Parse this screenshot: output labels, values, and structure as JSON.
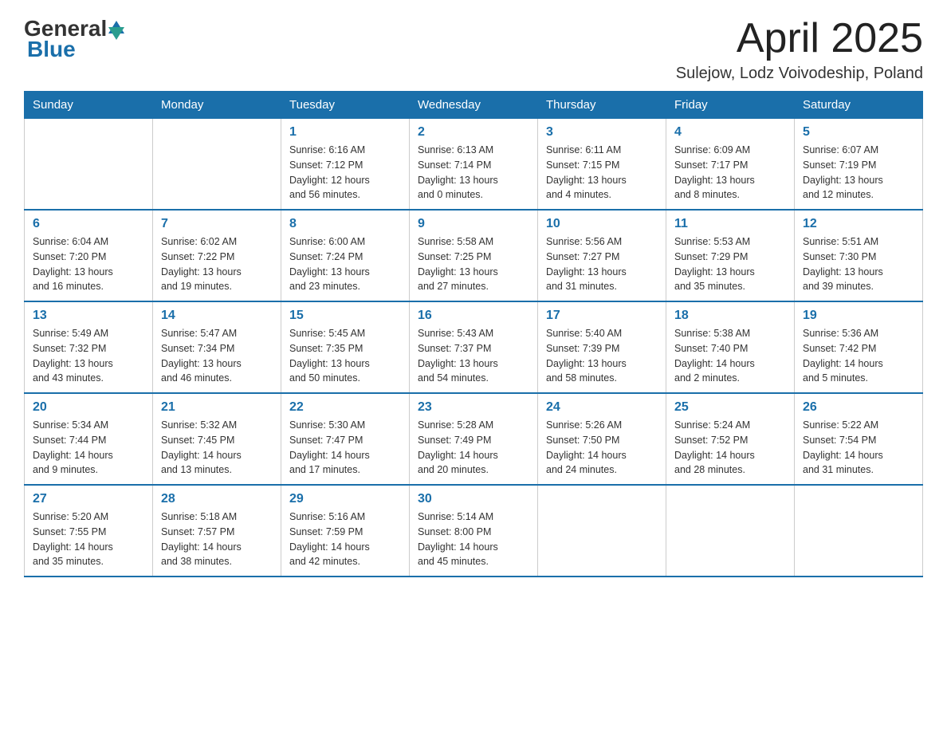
{
  "header": {
    "logo_general": "General",
    "logo_blue": "Blue",
    "month_title": "April 2025",
    "location": "Sulejow, Lodz Voivodeship, Poland"
  },
  "weekdays": [
    "Sunday",
    "Monday",
    "Tuesday",
    "Wednesday",
    "Thursday",
    "Friday",
    "Saturday"
  ],
  "weeks": [
    [
      {
        "day": "",
        "info": ""
      },
      {
        "day": "",
        "info": ""
      },
      {
        "day": "1",
        "info": "Sunrise: 6:16 AM\nSunset: 7:12 PM\nDaylight: 12 hours\nand 56 minutes."
      },
      {
        "day": "2",
        "info": "Sunrise: 6:13 AM\nSunset: 7:14 PM\nDaylight: 13 hours\nand 0 minutes."
      },
      {
        "day": "3",
        "info": "Sunrise: 6:11 AM\nSunset: 7:15 PM\nDaylight: 13 hours\nand 4 minutes."
      },
      {
        "day": "4",
        "info": "Sunrise: 6:09 AM\nSunset: 7:17 PM\nDaylight: 13 hours\nand 8 minutes."
      },
      {
        "day": "5",
        "info": "Sunrise: 6:07 AM\nSunset: 7:19 PM\nDaylight: 13 hours\nand 12 minutes."
      }
    ],
    [
      {
        "day": "6",
        "info": "Sunrise: 6:04 AM\nSunset: 7:20 PM\nDaylight: 13 hours\nand 16 minutes."
      },
      {
        "day": "7",
        "info": "Sunrise: 6:02 AM\nSunset: 7:22 PM\nDaylight: 13 hours\nand 19 minutes."
      },
      {
        "day": "8",
        "info": "Sunrise: 6:00 AM\nSunset: 7:24 PM\nDaylight: 13 hours\nand 23 minutes."
      },
      {
        "day": "9",
        "info": "Sunrise: 5:58 AM\nSunset: 7:25 PM\nDaylight: 13 hours\nand 27 minutes."
      },
      {
        "day": "10",
        "info": "Sunrise: 5:56 AM\nSunset: 7:27 PM\nDaylight: 13 hours\nand 31 minutes."
      },
      {
        "day": "11",
        "info": "Sunrise: 5:53 AM\nSunset: 7:29 PM\nDaylight: 13 hours\nand 35 minutes."
      },
      {
        "day": "12",
        "info": "Sunrise: 5:51 AM\nSunset: 7:30 PM\nDaylight: 13 hours\nand 39 minutes."
      }
    ],
    [
      {
        "day": "13",
        "info": "Sunrise: 5:49 AM\nSunset: 7:32 PM\nDaylight: 13 hours\nand 43 minutes."
      },
      {
        "day": "14",
        "info": "Sunrise: 5:47 AM\nSunset: 7:34 PM\nDaylight: 13 hours\nand 46 minutes."
      },
      {
        "day": "15",
        "info": "Sunrise: 5:45 AM\nSunset: 7:35 PM\nDaylight: 13 hours\nand 50 minutes."
      },
      {
        "day": "16",
        "info": "Sunrise: 5:43 AM\nSunset: 7:37 PM\nDaylight: 13 hours\nand 54 minutes."
      },
      {
        "day": "17",
        "info": "Sunrise: 5:40 AM\nSunset: 7:39 PM\nDaylight: 13 hours\nand 58 minutes."
      },
      {
        "day": "18",
        "info": "Sunrise: 5:38 AM\nSunset: 7:40 PM\nDaylight: 14 hours\nand 2 minutes."
      },
      {
        "day": "19",
        "info": "Sunrise: 5:36 AM\nSunset: 7:42 PM\nDaylight: 14 hours\nand 5 minutes."
      }
    ],
    [
      {
        "day": "20",
        "info": "Sunrise: 5:34 AM\nSunset: 7:44 PM\nDaylight: 14 hours\nand 9 minutes."
      },
      {
        "day": "21",
        "info": "Sunrise: 5:32 AM\nSunset: 7:45 PM\nDaylight: 14 hours\nand 13 minutes."
      },
      {
        "day": "22",
        "info": "Sunrise: 5:30 AM\nSunset: 7:47 PM\nDaylight: 14 hours\nand 17 minutes."
      },
      {
        "day": "23",
        "info": "Sunrise: 5:28 AM\nSunset: 7:49 PM\nDaylight: 14 hours\nand 20 minutes."
      },
      {
        "day": "24",
        "info": "Sunrise: 5:26 AM\nSunset: 7:50 PM\nDaylight: 14 hours\nand 24 minutes."
      },
      {
        "day": "25",
        "info": "Sunrise: 5:24 AM\nSunset: 7:52 PM\nDaylight: 14 hours\nand 28 minutes."
      },
      {
        "day": "26",
        "info": "Sunrise: 5:22 AM\nSunset: 7:54 PM\nDaylight: 14 hours\nand 31 minutes."
      }
    ],
    [
      {
        "day": "27",
        "info": "Sunrise: 5:20 AM\nSunset: 7:55 PM\nDaylight: 14 hours\nand 35 minutes."
      },
      {
        "day": "28",
        "info": "Sunrise: 5:18 AM\nSunset: 7:57 PM\nDaylight: 14 hours\nand 38 minutes."
      },
      {
        "day": "29",
        "info": "Sunrise: 5:16 AM\nSunset: 7:59 PM\nDaylight: 14 hours\nand 42 minutes."
      },
      {
        "day": "30",
        "info": "Sunrise: 5:14 AM\nSunset: 8:00 PM\nDaylight: 14 hours\nand 45 minutes."
      },
      {
        "day": "",
        "info": ""
      },
      {
        "day": "",
        "info": ""
      },
      {
        "day": "",
        "info": ""
      }
    ]
  ]
}
